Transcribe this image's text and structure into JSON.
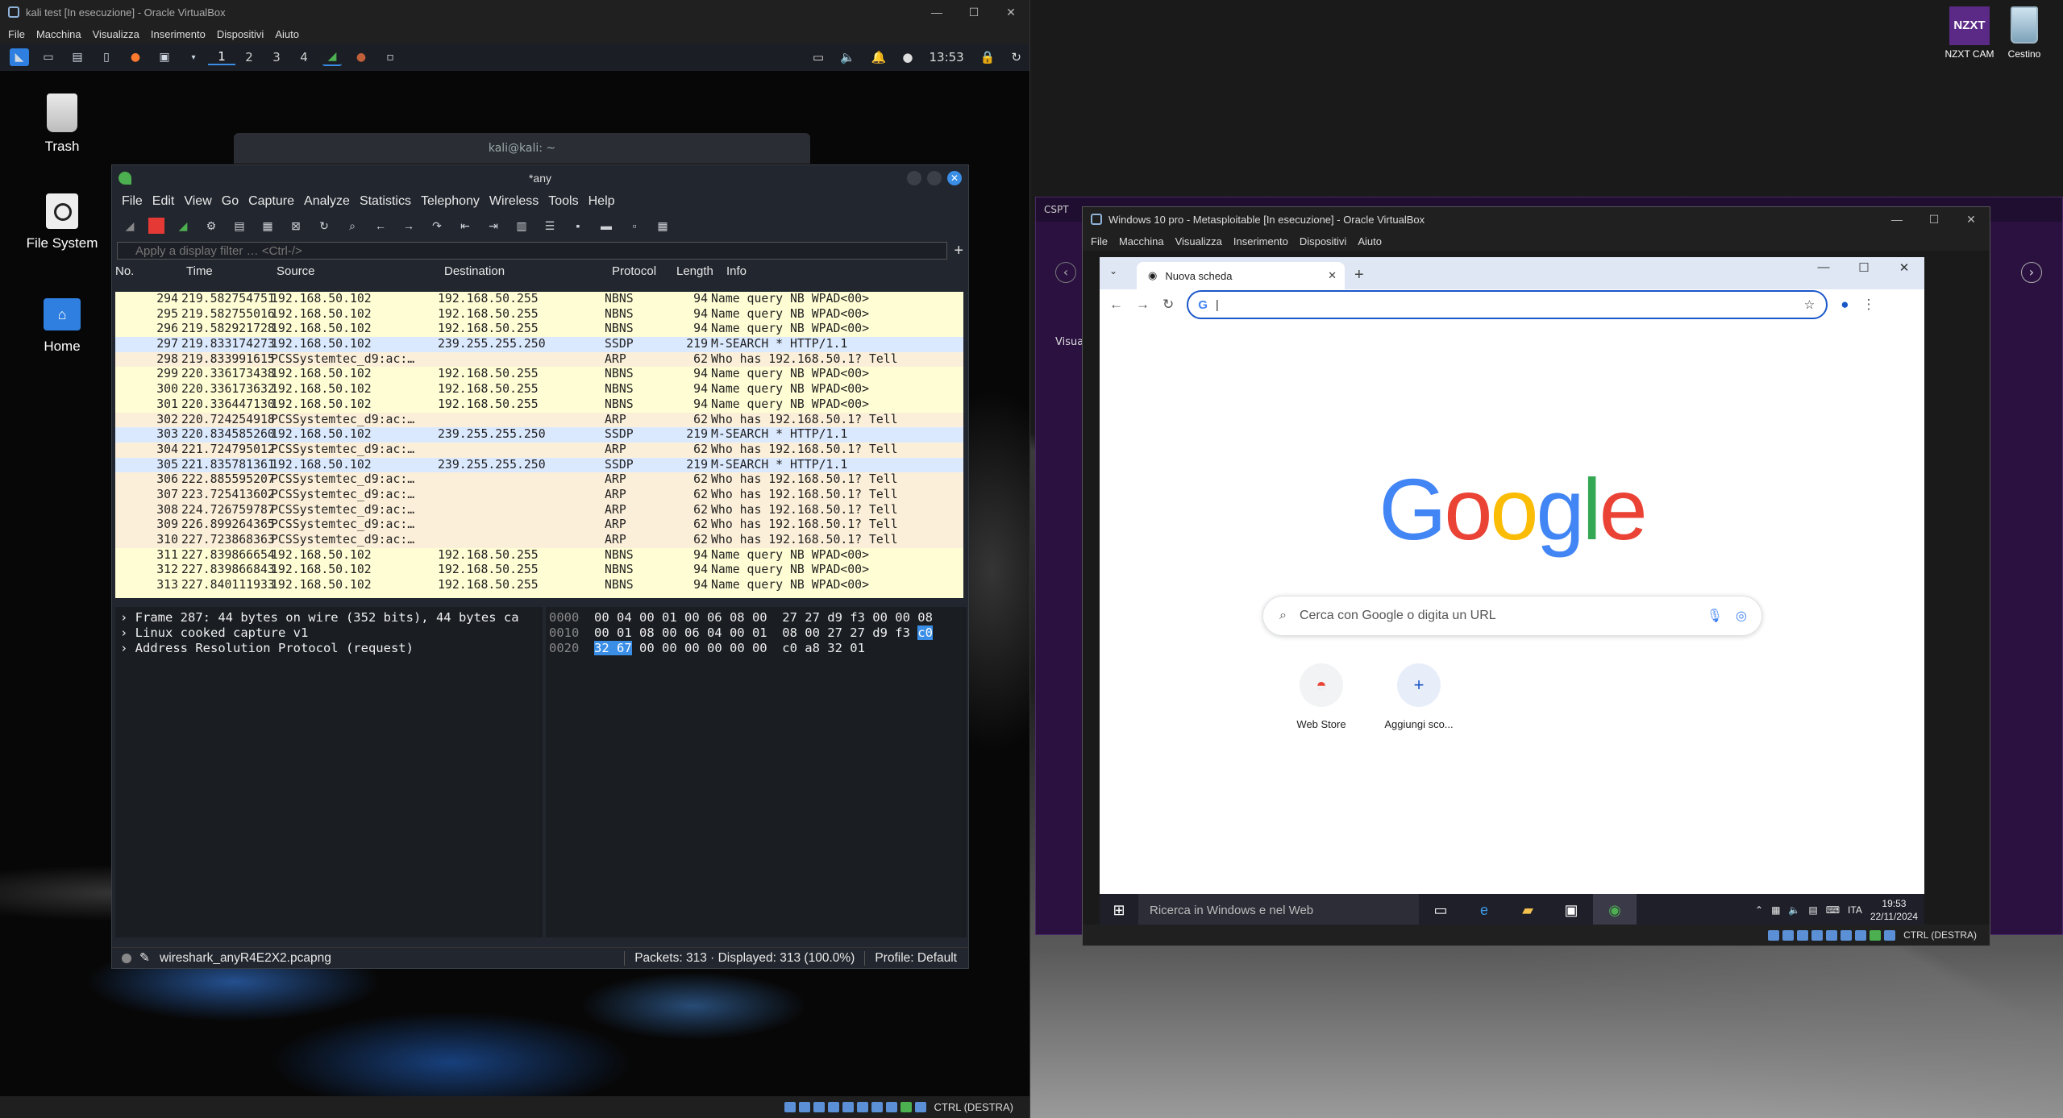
{
  "host": {
    "icons": [
      {
        "label": "NZXT CAM",
        "logo_text": "NZXT"
      },
      {
        "label": "Cestino"
      }
    ]
  },
  "vbox_kali": {
    "title": "kali test [In esecuzione] - Oracle VirtualBox",
    "menu": [
      "File",
      "Macchina",
      "Visualizza",
      "Inserimento",
      "Dispositivi",
      "Aiuto"
    ],
    "status_text": "CTRL (DESTRA)"
  },
  "kali_panel": {
    "workspaces": [
      "1",
      "2",
      "3",
      "4"
    ],
    "active_workspace": "1",
    "time": "13:53"
  },
  "kali_desktop": {
    "icons": [
      "Trash",
      "File System",
      "Home"
    ],
    "terminal_title": "kali@kali: ~"
  },
  "wireshark": {
    "title": "*any",
    "menu": [
      "File",
      "Edit",
      "View",
      "Go",
      "Capture",
      "Analyze",
      "Statistics",
      "Telephony",
      "Wireless",
      "Tools",
      "Help"
    ],
    "filter_placeholder": "Apply a display filter … <Ctrl-/>",
    "columns": [
      "No.",
      "Time",
      "Source",
      "Destination",
      "Protocol",
      "Length",
      "Info"
    ],
    "packets": [
      {
        "no": "294",
        "time": "219.582754751",
        "src": "192.168.50.102",
        "dst": "192.168.50.255",
        "proto": "NBNS",
        "len": "94",
        "info": "Name query NB WPAD<00>"
      },
      {
        "no": "295",
        "time": "219.582755016",
        "src": "192.168.50.102",
        "dst": "192.168.50.255",
        "proto": "NBNS",
        "len": "94",
        "info": "Name query NB WPAD<00>"
      },
      {
        "no": "296",
        "time": "219.582921728",
        "src": "192.168.50.102",
        "dst": "192.168.50.255",
        "proto": "NBNS",
        "len": "94",
        "info": "Name query NB WPAD<00>"
      },
      {
        "no": "297",
        "time": "219.833174273",
        "src": "192.168.50.102",
        "dst": "239.255.255.250",
        "proto": "SSDP",
        "len": "219",
        "info": "M-SEARCH * HTTP/1.1"
      },
      {
        "no": "298",
        "time": "219.833991615",
        "src": "PCSSystemtec_d9:ac:…",
        "dst": "",
        "proto": "ARP",
        "len": "62",
        "info": "Who has 192.168.50.1? Tell"
      },
      {
        "no": "299",
        "time": "220.336173438",
        "src": "192.168.50.102",
        "dst": "192.168.50.255",
        "proto": "NBNS",
        "len": "94",
        "info": "Name query NB WPAD<00>"
      },
      {
        "no": "300",
        "time": "220.336173632",
        "src": "192.168.50.102",
        "dst": "192.168.50.255",
        "proto": "NBNS",
        "len": "94",
        "info": "Name query NB WPAD<00>"
      },
      {
        "no": "301",
        "time": "220.336447130",
        "src": "192.168.50.102",
        "dst": "192.168.50.255",
        "proto": "NBNS",
        "len": "94",
        "info": "Name query NB WPAD<00>"
      },
      {
        "no": "302",
        "time": "220.724254918",
        "src": "PCSSystemtec_d9:ac:…",
        "dst": "",
        "proto": "ARP",
        "len": "62",
        "info": "Who has 192.168.50.1? Tell"
      },
      {
        "no": "303",
        "time": "220.834585260",
        "src": "192.168.50.102",
        "dst": "239.255.255.250",
        "proto": "SSDP",
        "len": "219",
        "info": "M-SEARCH * HTTP/1.1"
      },
      {
        "no": "304",
        "time": "221.724795012",
        "src": "PCSSystemtec_d9:ac:…",
        "dst": "",
        "proto": "ARP",
        "len": "62",
        "info": "Who has 192.168.50.1? Tell"
      },
      {
        "no": "305",
        "time": "221.835781361",
        "src": "192.168.50.102",
        "dst": "239.255.255.250",
        "proto": "SSDP",
        "len": "219",
        "info": "M-SEARCH * HTTP/1.1"
      },
      {
        "no": "306",
        "time": "222.885595207",
        "src": "PCSSystemtec_d9:ac:…",
        "dst": "",
        "proto": "ARP",
        "len": "62",
        "info": "Who has 192.168.50.1? Tell"
      },
      {
        "no": "307",
        "time": "223.725413602",
        "src": "PCSSystemtec_d9:ac:…",
        "dst": "",
        "proto": "ARP",
        "len": "62",
        "info": "Who has 192.168.50.1? Tell"
      },
      {
        "no": "308",
        "time": "224.726759787",
        "src": "PCSSystemtec_d9:ac:…",
        "dst": "",
        "proto": "ARP",
        "len": "62",
        "info": "Who has 192.168.50.1? Tell"
      },
      {
        "no": "309",
        "time": "226.899264365",
        "src": "PCSSystemtec_d9:ac:…",
        "dst": "",
        "proto": "ARP",
        "len": "62",
        "info": "Who has 192.168.50.1? Tell"
      },
      {
        "no": "310",
        "time": "227.723868363",
        "src": "PCSSystemtec_d9:ac:…",
        "dst": "",
        "proto": "ARP",
        "len": "62",
        "info": "Who has 192.168.50.1? Tell"
      },
      {
        "no": "311",
        "time": "227.839866654",
        "src": "192.168.50.102",
        "dst": "192.168.50.255",
        "proto": "NBNS",
        "len": "94",
        "info": "Name query NB WPAD<00>"
      },
      {
        "no": "312",
        "time": "227.839866843",
        "src": "192.168.50.102",
        "dst": "192.168.50.255",
        "proto": "NBNS",
        "len": "94",
        "info": "Name query NB WPAD<00>"
      },
      {
        "no": "313",
        "time": "227.840111933",
        "src": "192.168.50.102",
        "dst": "192.168.50.255",
        "proto": "NBNS",
        "len": "94",
        "info": "Name query NB WPAD<00>"
      }
    ],
    "details": [
      "Frame 287: 44 bytes on wire (352 bits), 44 bytes ca",
      "Linux cooked capture v1",
      "Address Resolution Protocol (request)"
    ],
    "hex": [
      {
        "off": "0000",
        "bytes": "00 04 00 01 00 06 08 00  27 27 d9 f3 00 00 08"
      },
      {
        "off": "0010",
        "bytes": "00 01 08 00 06 04 00 01  08 00 27 27 d9 f3",
        "hl_tail": "c0"
      },
      {
        "off": "0020",
        "hl_head": "32 67",
        "bytes": " 00 00 00 00 00 00  c0 a8 32 01"
      }
    ],
    "status_file": "wireshark_anyR4E2X2.pcapng",
    "status_packets": "Packets: 313 · Displayed: 313 (100.0%)",
    "status_profile": "Profile: Default"
  },
  "vbox_win": {
    "title": "Windows 10 pro - Metasploitable [In esecuzione] - Oracle VirtualBox",
    "menu": [
      "File",
      "Macchina",
      "Visualizza",
      "Inserimento",
      "Dispositivi",
      "Aiuto"
    ],
    "status_text": "CTRL (DESTRA)"
  },
  "chrome": {
    "tab_title": "Nuova scheda",
    "search_placeholder": "Cerca con Google o digita un URL",
    "logo_letters": [
      {
        "ch": "G",
        "color": "#4285f4"
      },
      {
        "ch": "o",
        "color": "#ea4335"
      },
      {
        "ch": "o",
        "color": "#fbbc05"
      },
      {
        "ch": "g",
        "color": "#4285f4"
      },
      {
        "ch": "l",
        "color": "#34a853"
      },
      {
        "ch": "e",
        "color": "#ea4335"
      }
    ],
    "shortcuts": [
      "Web Store",
      "Aggiungi sco..."
    ]
  },
  "win_taskbar": {
    "search_placeholder": "Ricerca in Windows e nel Web",
    "lang": "ITA",
    "time": "19:53",
    "date": "22/11/2024"
  },
  "purple_app": {
    "title": "CSPT",
    "side_label": "Visua"
  }
}
